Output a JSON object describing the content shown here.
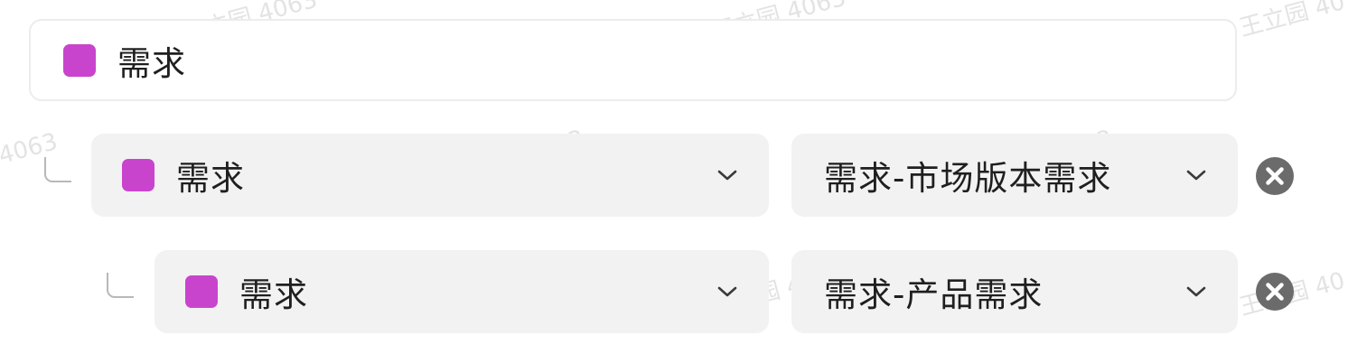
{
  "watermark": {
    "text": "王立园 4063",
    "visible_fragments": [
      "王立园 4063",
      "王立园 4063",
      "王立园 40",
      "4063",
      "王立园 4063",
      "王立园 4063",
      "王立园 40",
      "王立园 40",
      "王立园 40"
    ]
  },
  "root": {
    "label": "需求",
    "color": "#c944cc"
  },
  "rows": [
    {
      "type": {
        "label": "需求",
        "color": "#c944cc"
      },
      "category": {
        "value": "需求-市场版本需求"
      },
      "remove_icon": "close-circle-icon"
    },
    {
      "type": {
        "label": "需求",
        "color": "#c944cc"
      },
      "category": {
        "value": "需求-产品需求"
      },
      "remove_icon": "close-circle-icon"
    }
  ],
  "colors": {
    "accent": "#c944cc",
    "select_bg": "#f2f2f2",
    "icon": "#6b6b6b"
  }
}
